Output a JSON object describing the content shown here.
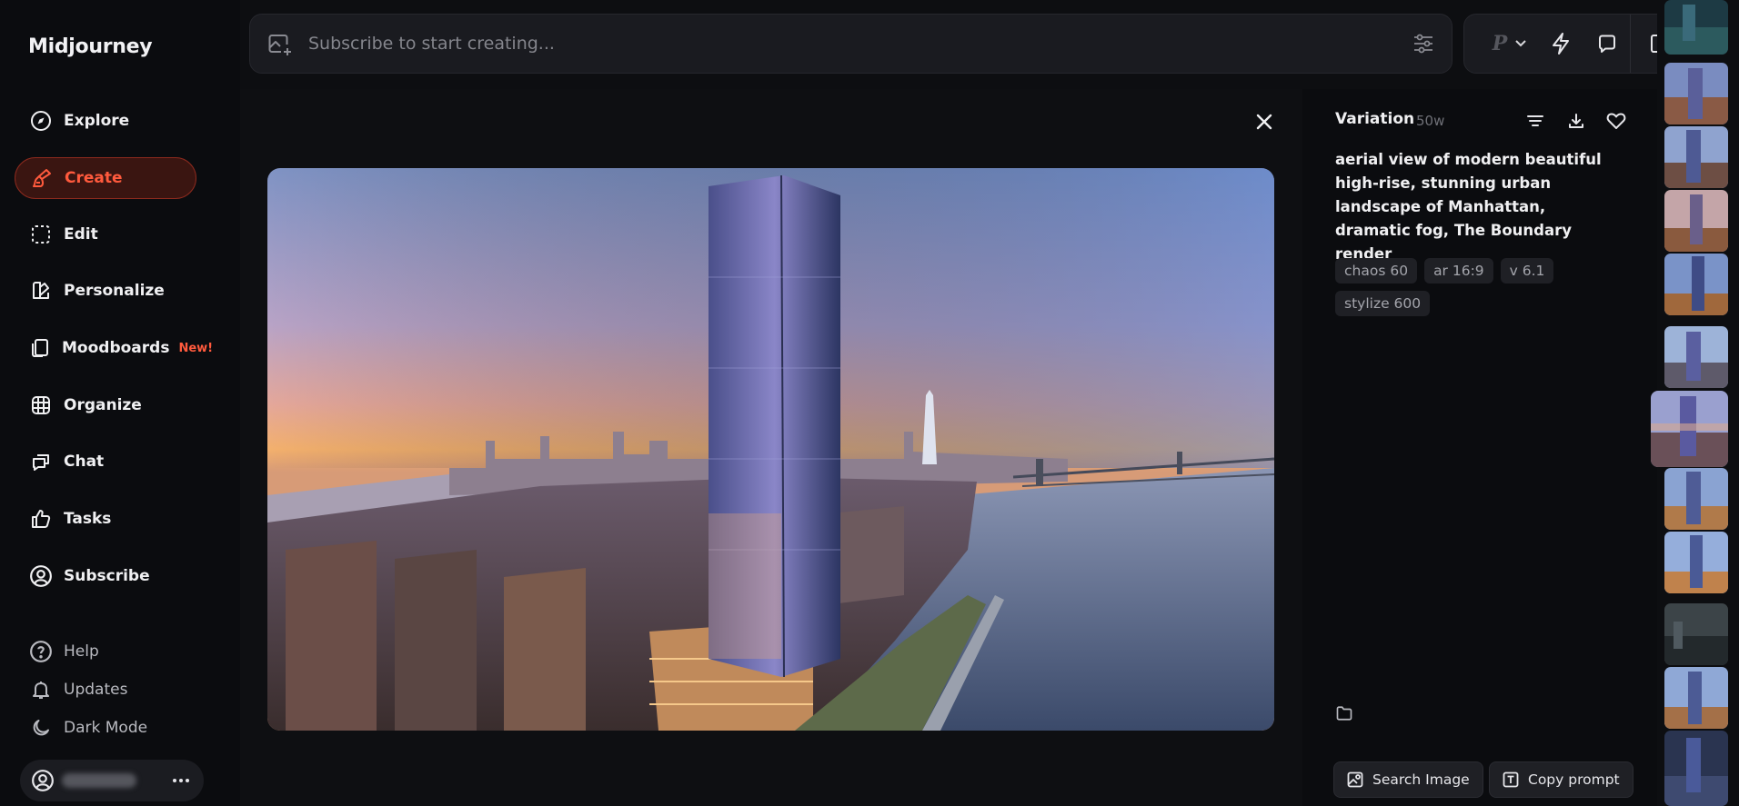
{
  "app": {
    "name": "Midjourney"
  },
  "sidebar": {
    "nav": [
      {
        "label": "Explore",
        "icon": "compass-icon"
      },
      {
        "label": "Create",
        "icon": "brush-icon",
        "active": true
      },
      {
        "label": "Edit",
        "icon": "edit-frame-icon"
      },
      {
        "label": "Personalize",
        "icon": "personalize-icon"
      },
      {
        "label": "Moodboards",
        "icon": "moodboard-icon",
        "badge": "New!"
      },
      {
        "label": "Organize",
        "icon": "grid-icon"
      },
      {
        "label": "Chat",
        "icon": "chat-icon"
      },
      {
        "label": "Tasks",
        "icon": "thumbs-up-icon"
      },
      {
        "label": "Subscribe",
        "icon": "user-circle-icon"
      }
    ],
    "secondary": [
      {
        "label": "Help",
        "icon": "help-icon"
      },
      {
        "label": "Updates",
        "icon": "bell-icon"
      },
      {
        "label": "Dark Mode",
        "icon": "moon-icon"
      }
    ]
  },
  "search": {
    "placeholder": "Subscribe to start creating..."
  },
  "toolbar": {
    "personalize_label": "P"
  },
  "details": {
    "title": "Variation",
    "meta": "50w",
    "prompt": "aerial view of modern beautiful high-rise, stunning urban landscape of Manhattan, dramatic fog, The Boundary render",
    "params": [
      "chaos 60",
      "ar 16:9",
      "v 6.1",
      "stylize 600"
    ],
    "search_image_label": "Search Image",
    "copy_prompt_label": "Copy prompt"
  },
  "colors": {
    "accent": "#ff5a3d",
    "active_bg": "#3a1511",
    "background": "#0d0e11",
    "panel": "#1a1b20"
  }
}
